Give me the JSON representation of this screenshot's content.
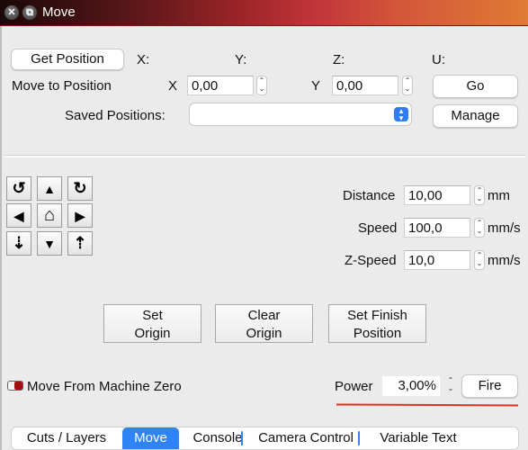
{
  "window": {
    "title": "Move",
    "close_icon": "close-icon",
    "restore_icon": "restore-icon"
  },
  "position": {
    "get_position_label": "Get Position",
    "axis_readouts": [
      {
        "label": "X:",
        "value": ""
      },
      {
        "label": "Y:",
        "value": ""
      },
      {
        "label": "Z:",
        "value": ""
      },
      {
        "label": "U:",
        "value": ""
      }
    ],
    "move_to_label": "Move to Position",
    "x_label": "X",
    "x_value": "0,00",
    "y_label": "Y",
    "y_value": "0,00",
    "go_label": "Go",
    "saved_positions_label": "Saved Positions:",
    "saved_positions_value": "",
    "manage_label": "Manage"
  },
  "jog": {
    "buttons": [
      {
        "name": "rotate-ccw",
        "glyph": "↺"
      },
      {
        "name": "up",
        "glyph": "▲"
      },
      {
        "name": "rotate-cw",
        "glyph": "↻"
      },
      {
        "name": "left",
        "glyph": "◀"
      },
      {
        "name": "home",
        "glyph": "⌂"
      },
      {
        "name": "right",
        "glyph": "▶"
      },
      {
        "name": "z-down",
        "glyph": "⇣"
      },
      {
        "name": "down",
        "glyph": "▼"
      },
      {
        "name": "z-up",
        "glyph": "⇡"
      }
    ]
  },
  "settings": {
    "distance_label": "Distance",
    "distance_value": "10,00",
    "distance_unit": "mm",
    "speed_label": "Speed",
    "speed_value": "100,0",
    "speed_unit": "mm/s",
    "zspeed_label": "Z-Speed",
    "zspeed_value": "10,0",
    "zspeed_unit": "mm/s"
  },
  "origin": {
    "set_origin_line1": "Set",
    "set_origin_line2": "Origin",
    "clear_origin_line1": "Clear",
    "clear_origin_line2": "Origin",
    "set_finish_line1": "Set Finish",
    "set_finish_line2": "Position"
  },
  "bottom": {
    "move_from_zero_label": "Move From Machine Zero",
    "power_label": "Power",
    "power_value": "3,00%",
    "fire_label": "Fire"
  },
  "tabs": [
    {
      "label": "Cuts / Layers",
      "active": false
    },
    {
      "label": "Move",
      "active": true
    },
    {
      "label": "Console",
      "active": false
    },
    {
      "label": "Camera Control",
      "active": false
    },
    {
      "label": "Variable Text",
      "active": false
    }
  ],
  "colors": {
    "accent": "#2e84f7",
    "annotation_red": "#e0301e",
    "toggle_red": "#a01010"
  }
}
